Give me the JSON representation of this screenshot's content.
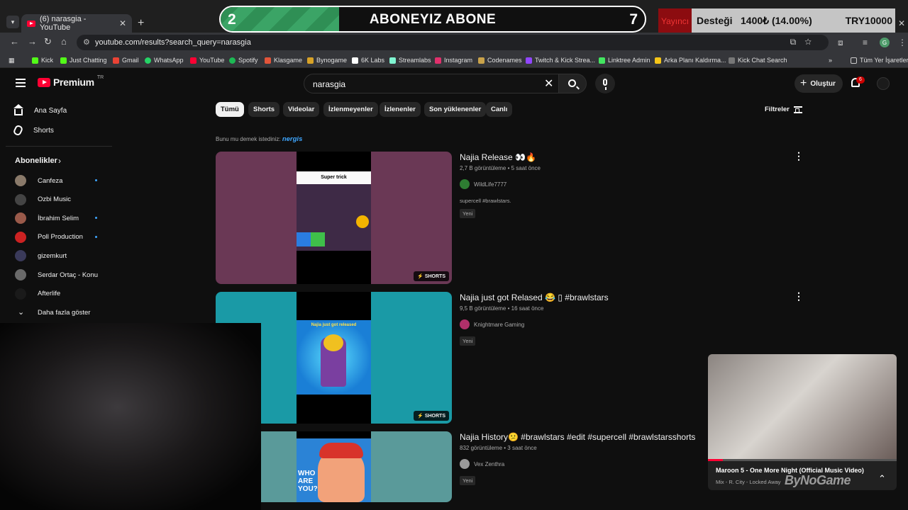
{
  "browser": {
    "tab_title": "(6) narasgia - YouTube",
    "new_tab": "+",
    "url": "youtube.com/results?search_query=narasgia",
    "bookmarks": [
      "Kick",
      "Just Chatting",
      "Gmail",
      "WhatsApp",
      "YouTube",
      "Spotify",
      "Klasgame",
      "Bynogame",
      "6K Labs",
      "Streamlabs",
      "Instagram",
      "Codenames",
      "Twitch & Kick Strea...",
      "Linktree Admin",
      "Arka Planı Kaldırma...",
      "Kick Chat Search"
    ],
    "bookmarks_more": "»",
    "all_bookmarks": "Tüm Yer İşaretleri",
    "profile_letter": "G"
  },
  "overlay": {
    "sub_goal": {
      "left": "2",
      "text": "ABONEYIZ ABONE",
      "right": "7",
      "progress": 0.28
    },
    "donation": {
      "prefix": "Yayıncı",
      "label": "Desteği",
      "amount": "1400₺ (14.00%)",
      "goal": "TRY10000",
      "progress": 0.14
    }
  },
  "youtube": {
    "logo": "Premium",
    "region": "TR",
    "search_value": "narasgia",
    "create_label": "Oluştur",
    "notification_count": "6",
    "sidebar": {
      "home": "Ana Sayfa",
      "shorts": "Shorts",
      "subs_title": "Abonelikler",
      "channels": [
        {
          "name": "Canfeza",
          "new": true,
          "color": "#8a7a6a"
        },
        {
          "name": "Ozbi Music",
          "new": false,
          "color": "#444444"
        },
        {
          "name": "İbrahim Selim",
          "new": true,
          "color": "#9a5a4a"
        },
        {
          "name": "Poll Production",
          "new": true,
          "color": "#cc2222"
        },
        {
          "name": "gizemkurt",
          "new": false,
          "color": "#3a3a5a"
        },
        {
          "name": "Serdar Ortaç - Konu",
          "new": false,
          "color": "#6a6a6a"
        },
        {
          "name": "Afterlife",
          "new": false,
          "color": "#1a1a1a"
        }
      ],
      "show_more": "Daha fazla göster"
    },
    "chips": [
      "Tümü",
      "Shorts",
      "Videolar",
      "İzlenmeyenler",
      "İzlenenler",
      "Son yüklenenler",
      "Canlı"
    ],
    "filters": "Filtreler",
    "suggestion": {
      "prefix": "Bunu mu demek istediniz:",
      "term": "nergis"
    },
    "results": [
      {
        "title": "Najia Release 👀🔥",
        "meta": "2,7 B görüntüleme • 5 saat önce",
        "channel": "WildLife7777",
        "channel_color": "#2e7d32",
        "desc": "supercell #brawlstars.",
        "badge": "Yeni",
        "tag": "⚡ SHORTS",
        "thumb_bg": "#6a3855",
        "thumb_text": "Super trick"
      },
      {
        "title": "Najia just got Relased 😂 ▯ #brawlstars",
        "meta": "9,5 B görüntüleme • 16 saat önce",
        "channel": "Knightmare Gaming",
        "channel_color": "#b0306a",
        "desc": "",
        "badge": "Yeni",
        "tag": "⚡ SHORTS",
        "thumb_bg": "#1a9aa6",
        "thumb_text": "Najia just got released"
      },
      {
        "title": "Najia History😕 #brawlstars #edit #supercell #brawlstarsshorts",
        "meta": "832 görüntüleme • 3 saat önce",
        "channel": "Vex Zenthra",
        "channel_color": "#9a9a9a",
        "desc": "",
        "badge": "Yeni",
        "tag": "",
        "thumb_bg": "#5a9a9a",
        "thumb_text": "WHO ARE YOU?"
      }
    ],
    "miniplayer": {
      "title": "Maroon 5 - One More Night (Official Music Video)",
      "subtitle": "Mix - R. City - Locked Away",
      "watermark": "ByNoGame",
      "progress": 0.08
    }
  }
}
